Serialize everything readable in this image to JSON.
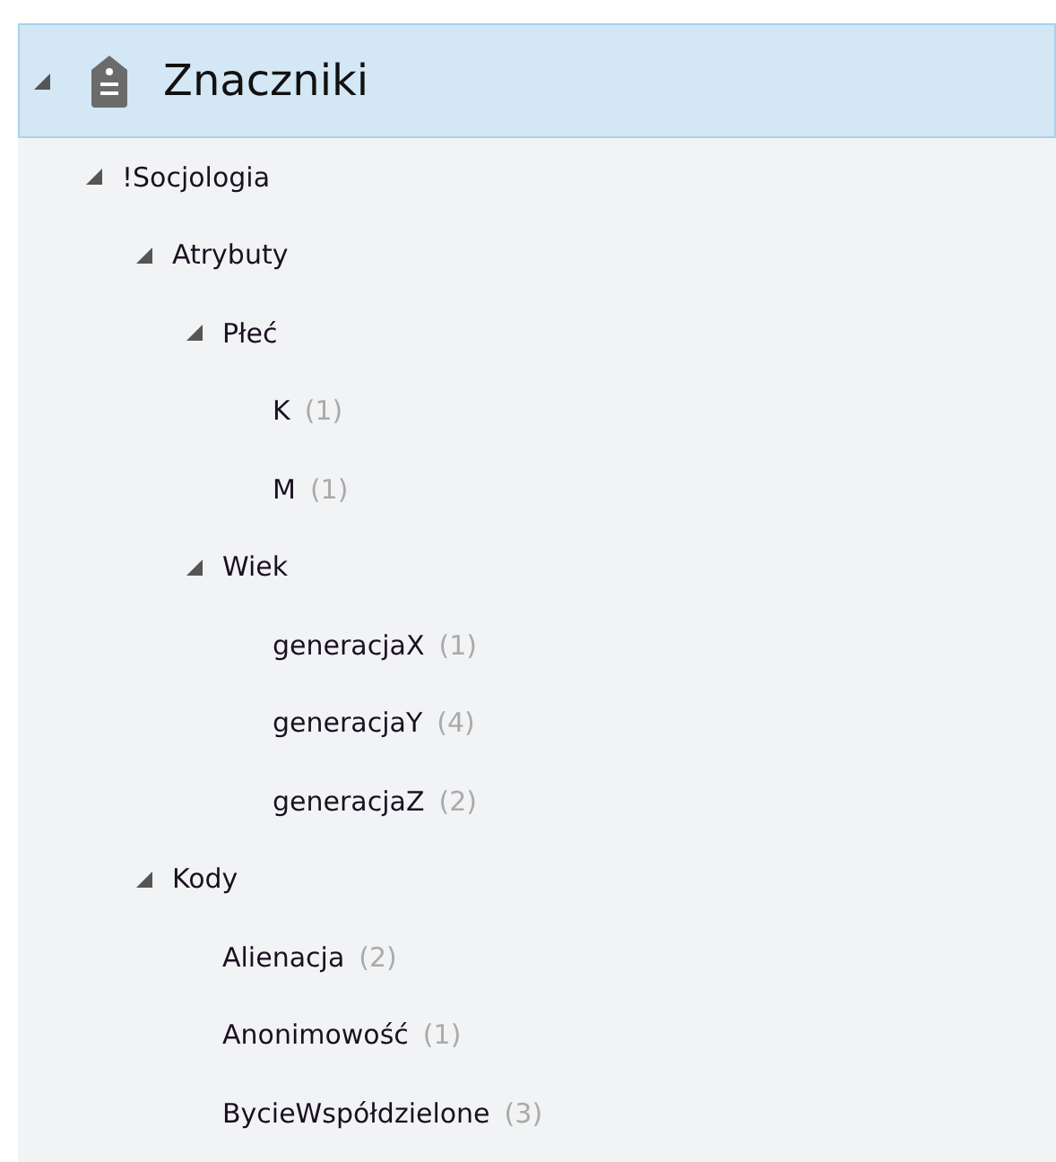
{
  "tree": {
    "label": "Znaczniki",
    "selected": true,
    "expanded": true,
    "children": [
      {
        "label": "!Socjologia",
        "selected": false,
        "expanded": true,
        "children": [
          {
            "label": "Atrybuty",
            "selected": false,
            "expanded": true,
            "children": [
              {
                "label": "Płeć",
                "selected": false,
                "expanded": true,
                "children": [
                  {
                    "label": "K",
                    "count": "(1)",
                    "selected": false
                  },
                  {
                    "label": "M",
                    "count": "(1)",
                    "selected": false
                  }
                ]
              },
              {
                "label": "Wiek",
                "selected": false,
                "expanded": true,
                "children": [
                  {
                    "label": "generacjaX",
                    "count": "(1)",
                    "selected": false
                  },
                  {
                    "label": "generacjaY",
                    "count": "(4)",
                    "selected": false
                  },
                  {
                    "label": "generacjaZ",
                    "count": "(2)",
                    "selected": false
                  }
                ]
              }
            ]
          },
          {
            "label": "Kody",
            "selected": false,
            "expanded": true,
            "children": [
              {
                "label": "Alienacja",
                "count": "(2)",
                "selected": false
              },
              {
                "label": "Anonimowość",
                "count": "(1)",
                "selected": false
              },
              {
                "label": "BycieWspółdzielone",
                "count": "(3)",
                "selected": false
              }
            ]
          }
        ]
      }
    ]
  }
}
